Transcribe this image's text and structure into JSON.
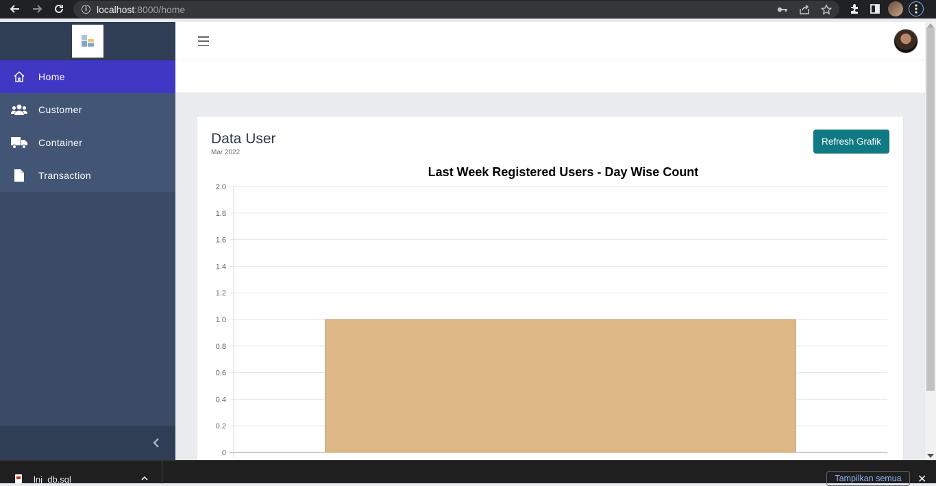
{
  "browser": {
    "url_host": "localhost",
    "url_rest": ":8000/home"
  },
  "sidebar": {
    "items": [
      {
        "label": "Home",
        "icon": "home-icon",
        "active": true
      },
      {
        "label": "Customer",
        "icon": "users-icon",
        "active": false
      },
      {
        "label": "Container",
        "icon": "truck-icon",
        "active": false
      },
      {
        "label": "Transaction",
        "icon": "file-icon",
        "active": false
      }
    ]
  },
  "card": {
    "title": "Data User",
    "subtitle": "Mar 2022",
    "refresh_label": "Refresh Grafik"
  },
  "chart_data": {
    "type": "bar",
    "title": "Last Week Registered Users -  Day Wise Count",
    "categories": [
      ""
    ],
    "values": [
      1
    ],
    "ylim": [
      0,
      2
    ],
    "yticks": [
      "0",
      "0.2",
      "0.4",
      "0.6",
      "0.8",
      "1.0",
      "1.2",
      "1.4",
      "1.6",
      "1.8",
      "2.0"
    ],
    "bar_color": "#deb887",
    "grid": true
  },
  "download_bar": {
    "file_name": "lnj_db.sql",
    "show_all_label": "Tampilkan semua"
  },
  "colors": {
    "sidebar": "#3b4b66",
    "active_menu": "#4137c5",
    "primary_button": "#0f7a84"
  }
}
